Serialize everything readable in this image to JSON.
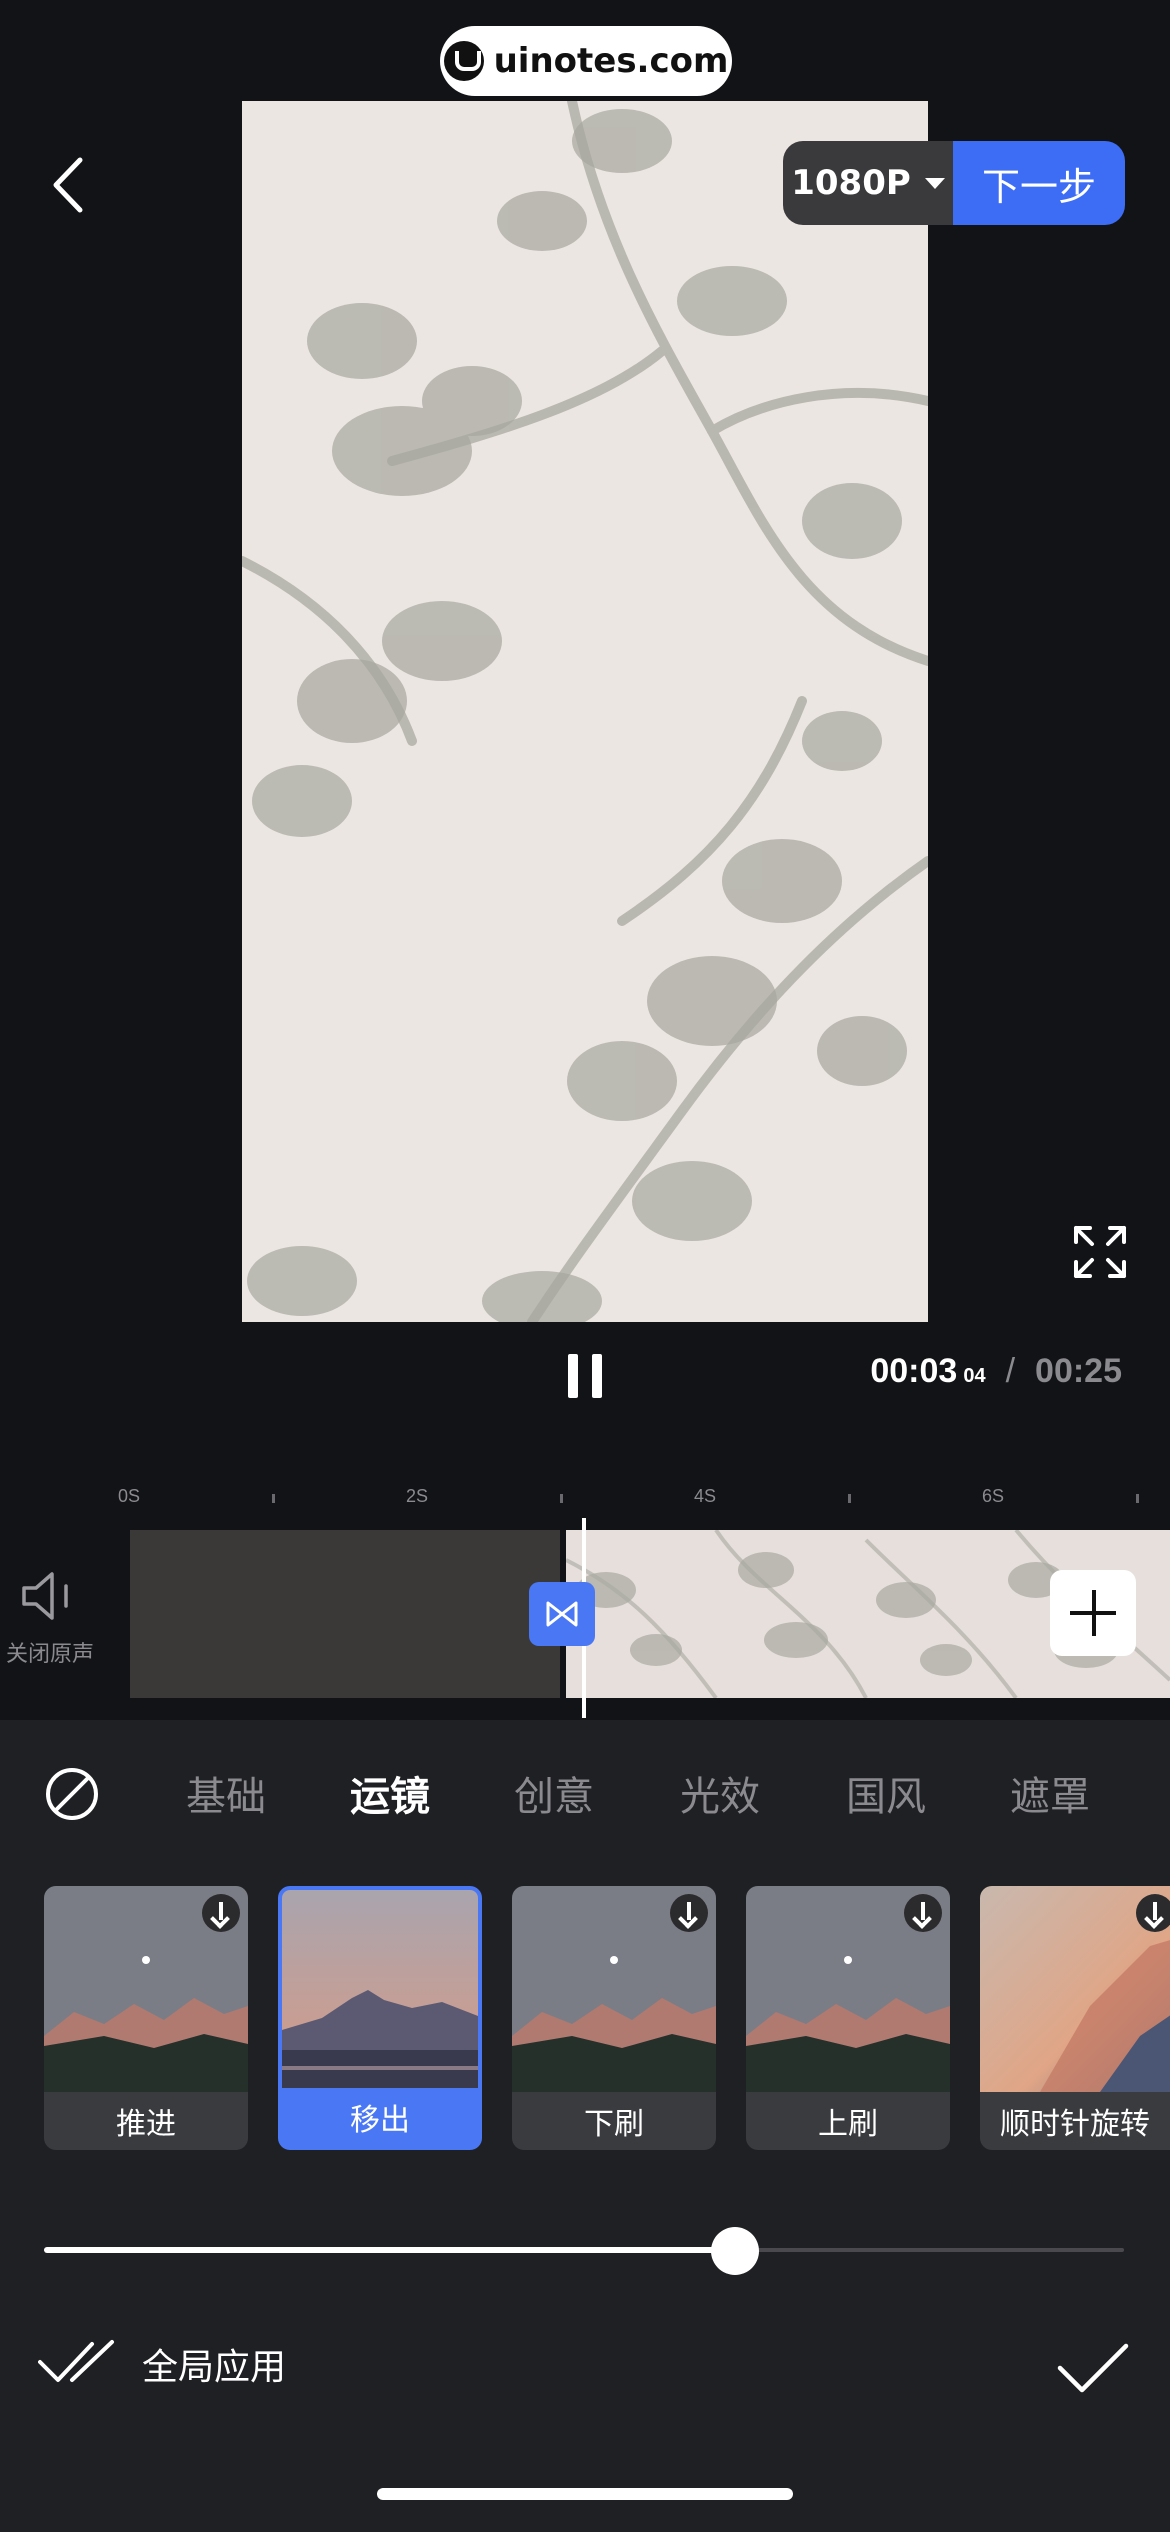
{
  "watermark": {
    "text": "uinotes.com"
  },
  "header": {
    "resolution": "1080P",
    "next_label": "下一步"
  },
  "player": {
    "current_time": "00:03",
    "current_frames": "04",
    "separator": "/",
    "total_time": "00:25"
  },
  "ruler": {
    "labels": [
      "0S",
      "2S",
      "4S",
      "6S"
    ]
  },
  "audio": {
    "mute_label": "关闭原声"
  },
  "categories": [
    {
      "label": "基础",
      "active": false
    },
    {
      "label": "运镜",
      "active": true
    },
    {
      "label": "创意",
      "active": false
    },
    {
      "label": "光效",
      "active": false
    },
    {
      "label": "国风",
      "active": false
    },
    {
      "label": "遮罩",
      "active": false
    }
  ],
  "effects": [
    {
      "label": "推进",
      "selected": false,
      "downloadable": true
    },
    {
      "label": "移出",
      "selected": true,
      "downloadable": false
    },
    {
      "label": "下刷",
      "selected": false,
      "downloadable": true
    },
    {
      "label": "上刷",
      "selected": false,
      "downloadable": true
    },
    {
      "label": "顺时针旋转",
      "selected": false,
      "downloadable": true
    }
  ],
  "duration_slider": {
    "value": 0.64
  },
  "footer": {
    "apply_all_label": "全局应用"
  },
  "colors": {
    "accent": "#3d6cf5",
    "background": "#121316",
    "panel": "#1f2023"
  }
}
